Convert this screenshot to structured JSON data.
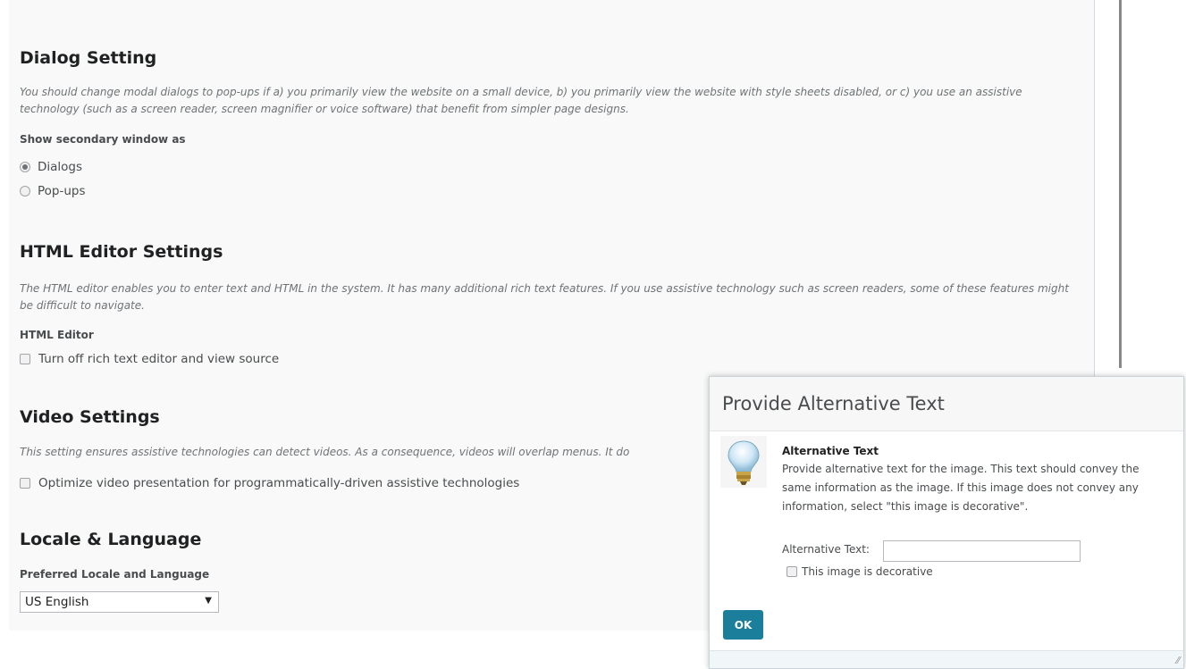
{
  "dialog_setting": {
    "title": "Dialog Setting",
    "description": "You should change modal dialogs to pop-ups if a) you primarily view the website on a small device, b) you primarily view the website with style sheets disabled, or c) you use an assistive technology (such as a screen reader, screen magnifier or voice software) that benefit from simpler page designs.",
    "label": "Show secondary window as",
    "options": [
      "Dialogs",
      "Pop-ups"
    ],
    "selected": "Dialogs"
  },
  "html_editor": {
    "title": "HTML Editor Settings",
    "description": "The HTML editor enables you to enter text and HTML in the system. It has many additional rich text features. If you use assistive technology such as screen readers, some of these features might be difficult to navigate.",
    "label": "HTML Editor",
    "checkbox": "Turn off rich text editor and view source",
    "checked": false
  },
  "video": {
    "title": "Video Settings",
    "description": "This setting ensures assistive technologies can detect videos. As a consequence, videos will overlap menus. It do",
    "checkbox": "Optimize video presentation for programmatically-driven assistive technologies",
    "checked": false
  },
  "locale": {
    "title": "Locale & Language",
    "label": "Preferred Locale and Language",
    "value": "US English",
    "arrow": "▼"
  },
  "dialog": {
    "header": "Provide Alternative Text",
    "section_title": "Alternative Text",
    "text": "Provide alternative text for the image. This text should convey the same information as the image. If this image does not convey any information, select \"this image is decorative\".",
    "alt_label": "Alternative Text:",
    "alt_value": "",
    "decorative_label": "This image is decorative",
    "decorative_checked": false,
    "ok_label": "OK",
    "resize_glyph": "⁄⁄",
    "icon": "lightbulb-icon"
  },
  "colors": {
    "ok_button": "#1b7e9b",
    "page_bg": "#f9f9f9"
  }
}
